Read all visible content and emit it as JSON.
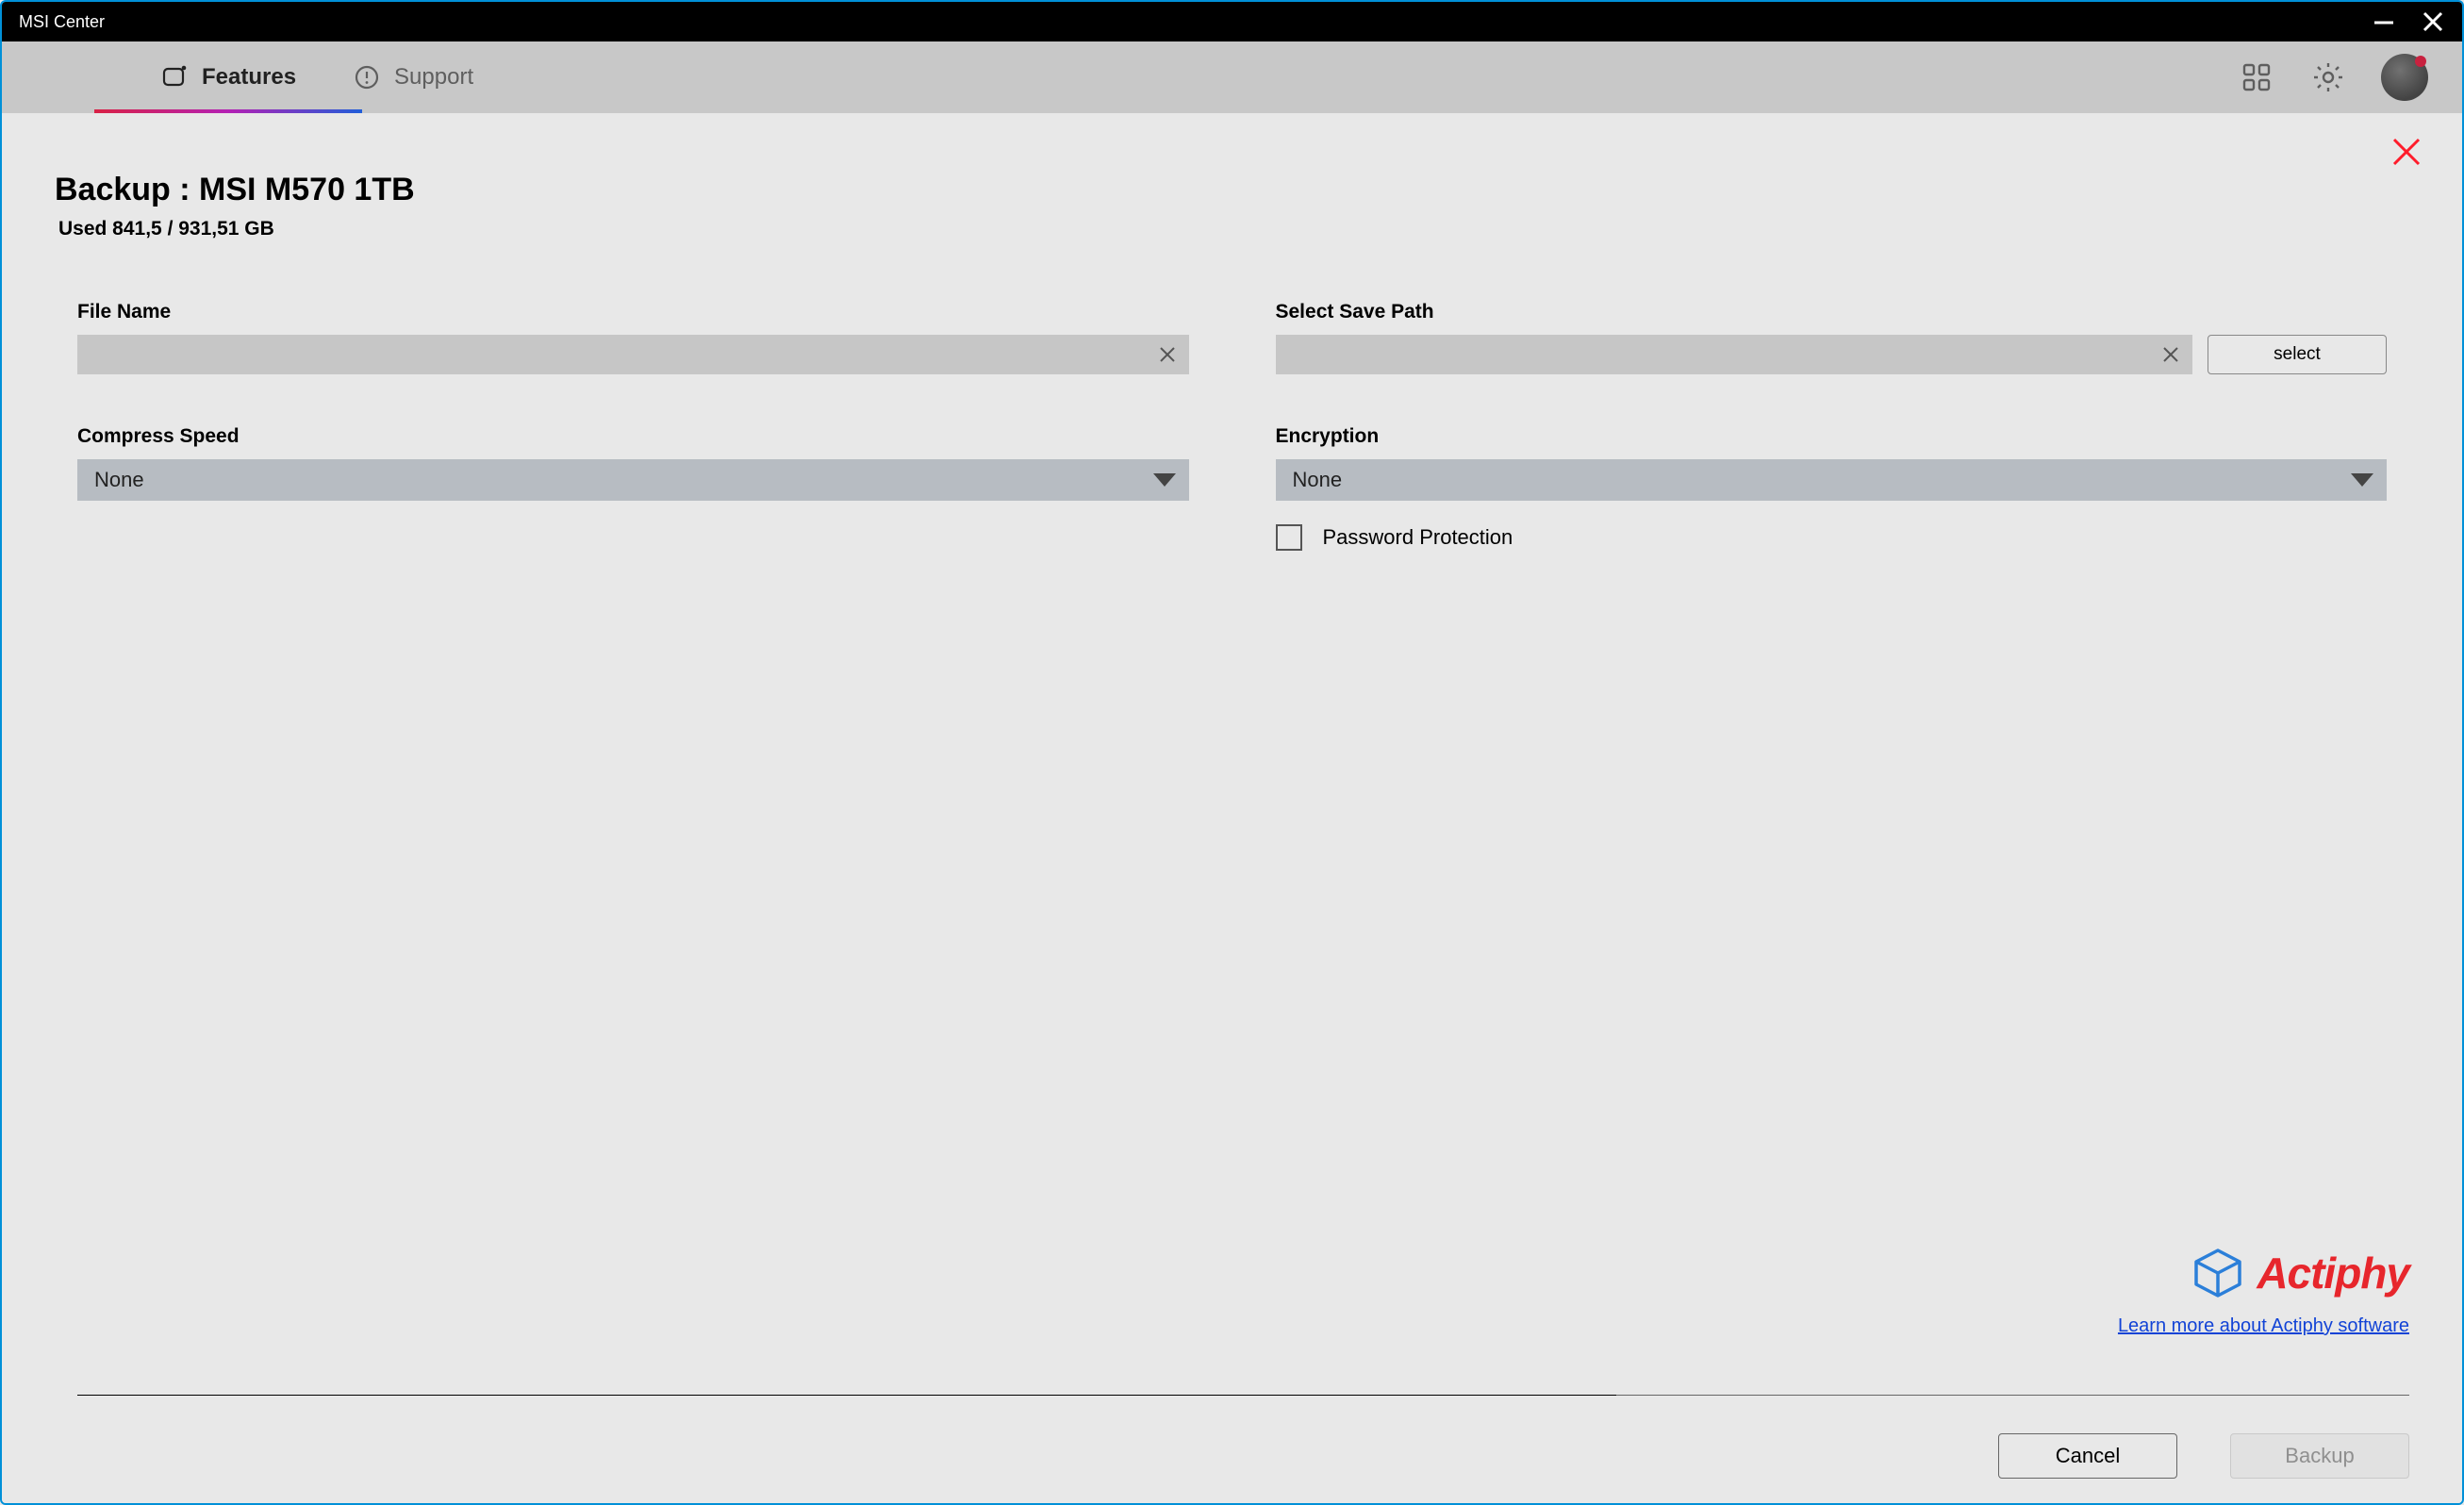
{
  "window": {
    "title": "MSI Center"
  },
  "header": {
    "tabs": [
      {
        "label": "Features",
        "active": true
      },
      {
        "label": "Support",
        "active": false
      }
    ]
  },
  "page": {
    "title": "Backup : MSI M570 1TB",
    "subtitle": "Used 841,5 / 931,51 GB",
    "fields": {
      "file_name": {
        "label": "File Name",
        "value": ""
      },
      "save_path": {
        "label": "Select Save Path",
        "value": "",
        "select_btn": "select"
      },
      "compress": {
        "label": "Compress Speed",
        "value": "None"
      },
      "encryption": {
        "label": "Encryption",
        "value": "None"
      },
      "password_protection": {
        "label": "Password Protection",
        "checked": false
      }
    },
    "brand": {
      "name": "Actiphy",
      "link_text": "Learn more about Actiphy software"
    },
    "actions": {
      "cancel": "Cancel",
      "backup": "Backup"
    }
  }
}
